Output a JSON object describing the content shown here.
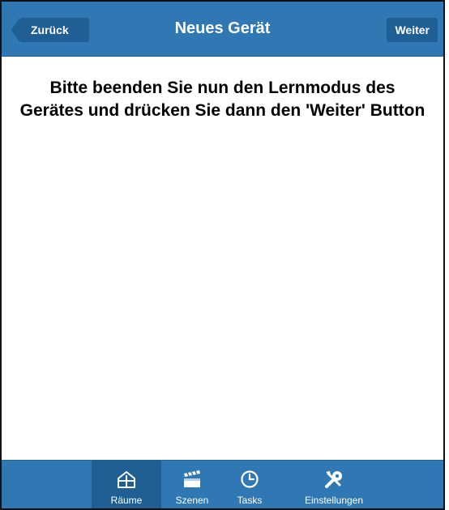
{
  "navbar": {
    "title": "Neues Gerät",
    "back_label": "Zurück",
    "next_label": "Weiter"
  },
  "content": {
    "instruction": "Bitte beenden Sie nun den Lernmodus des Gerätes und drücken Sie dann den 'Weiter' Button"
  },
  "tabbar": {
    "tabs": [
      {
        "label": "Räume",
        "icon": "house-icon",
        "active": true
      },
      {
        "label": "Szenen",
        "icon": "clapperboard-icon",
        "active": false
      },
      {
        "label": "Tasks",
        "icon": "clock-icon",
        "active": false
      },
      {
        "label": "Einstellungen",
        "icon": "tools-icon",
        "active": false
      }
    ]
  },
  "colors": {
    "bar_blue": "#2f78b3",
    "button_blue": "#1f5f94",
    "text": "#000000",
    "background": "#ffffff"
  }
}
